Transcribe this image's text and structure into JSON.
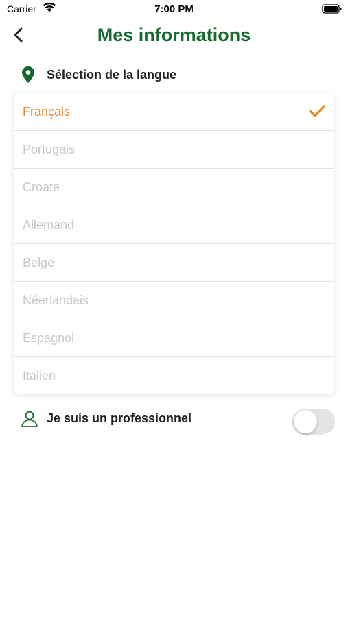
{
  "status_bar": {
    "carrier": "Carrier",
    "time": "7:00 PM"
  },
  "nav": {
    "title": "Mes informations",
    "back_icon": "chevron-left-icon"
  },
  "language_section": {
    "title": "Sélection de la langue",
    "icon": "location-pin-icon",
    "selected": "Français",
    "items": [
      {
        "label": "Français",
        "selected": true
      },
      {
        "label": "Portugais",
        "selected": false
      },
      {
        "label": "Croate",
        "selected": false
      },
      {
        "label": "Allemand",
        "selected": false
      },
      {
        "label": "Belge",
        "selected": false
      },
      {
        "label": "Néerlandais",
        "selected": false
      },
      {
        "label": "Espagnol",
        "selected": false
      },
      {
        "label": "Italien",
        "selected": false
      }
    ]
  },
  "professional": {
    "label": "Je suis un professionnel",
    "icon": "user-outline-icon",
    "enabled": false
  },
  "colors": {
    "title_green": "#156b2d",
    "accent_orange": "#e8892c",
    "unselected_text": "#c7c7c7"
  }
}
